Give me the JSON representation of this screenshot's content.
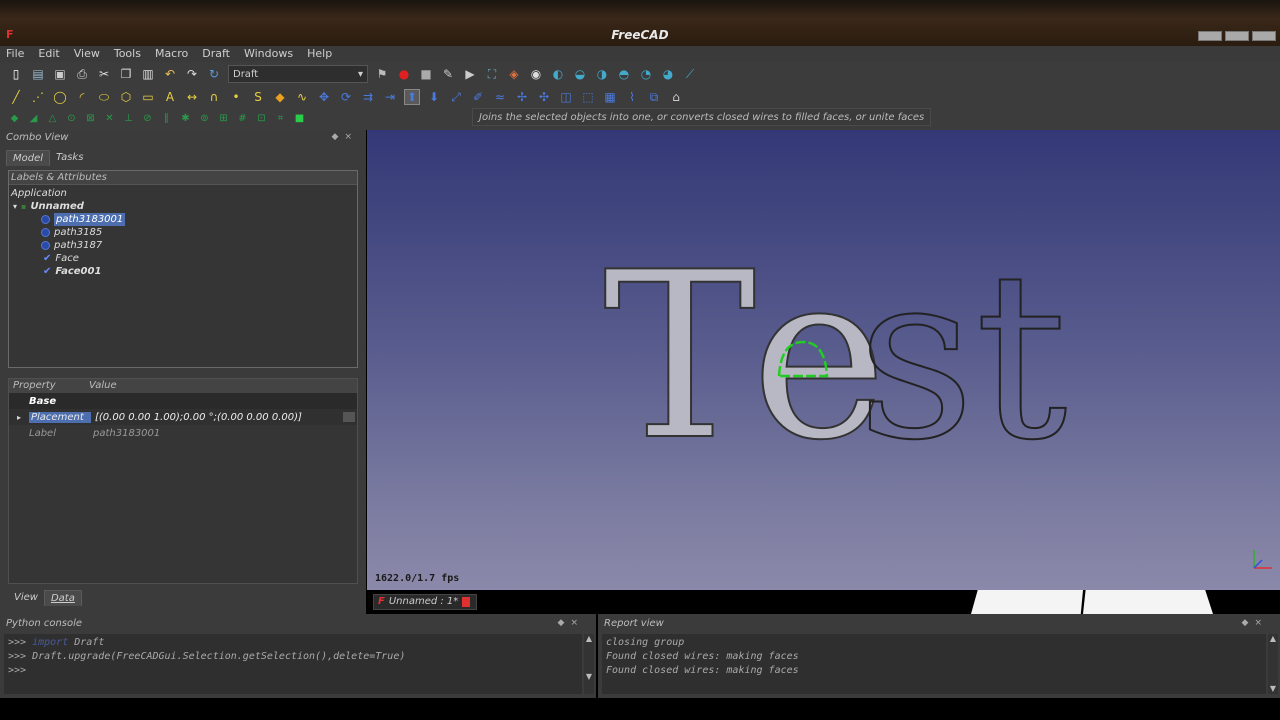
{
  "window": {
    "title": "FreeCAD"
  },
  "menu": [
    "File",
    "Edit",
    "View",
    "Tools",
    "Macro",
    "Draft",
    "Windows",
    "Help"
  ],
  "workbench": {
    "selected": "Draft"
  },
  "tooltip": "Joins the selected objects into one, or converts closed wires to filled faces, or unite faces",
  "combo_view": {
    "title": "Combo View",
    "tabs": [
      "Model",
      "Tasks"
    ],
    "tree_header": "Labels & Attributes",
    "application_label": "Application",
    "document": "Unnamed",
    "items": [
      {
        "label": "path3183001",
        "icon": "shape-icon",
        "selected": true
      },
      {
        "label": "path3185",
        "icon": "shape-icon",
        "selected": false
      },
      {
        "label": "path3187",
        "icon": "shape-icon",
        "selected": false
      },
      {
        "label": "Face",
        "icon": "face-check-icon",
        "selected": false
      },
      {
        "label": "Face001",
        "icon": "face-check-icon",
        "selected": false
      }
    ],
    "property_header": {
      "property": "Property",
      "value": "Value"
    },
    "property_group": "Base",
    "properties": [
      {
        "name": "Placement",
        "value": "[(0.00 0.00 1.00);0.00 °;(0.00 0.00 0.00)]"
      },
      {
        "name": "Label",
        "value": "path3183001"
      }
    ],
    "bottom_tabs": [
      "View",
      "Data"
    ]
  },
  "viewport": {
    "text": "Test",
    "coords": "1622.0/1.7 fps",
    "document_tab": "Unnamed : 1*"
  },
  "python_console": {
    "title": "Python console",
    "lines": [
      {
        "prompt": ">>>",
        "keyword": "import",
        "text": " Draft"
      },
      {
        "prompt": ">>>",
        "keyword": "",
        "text": " Draft.upgrade(FreeCADGui.Selection.getSelection(),delete=True)"
      },
      {
        "prompt": ">>>",
        "keyword": "",
        "text": ""
      }
    ]
  },
  "report_view": {
    "title": "Report view",
    "lines": [
      "closing group",
      "Found closed wires: making faces",
      "Found closed wires: making faces"
    ]
  },
  "colors": {
    "selection": "#4d6fb0",
    "viewport_top": "#343876",
    "viewport_bottom": "#8b89aa"
  }
}
